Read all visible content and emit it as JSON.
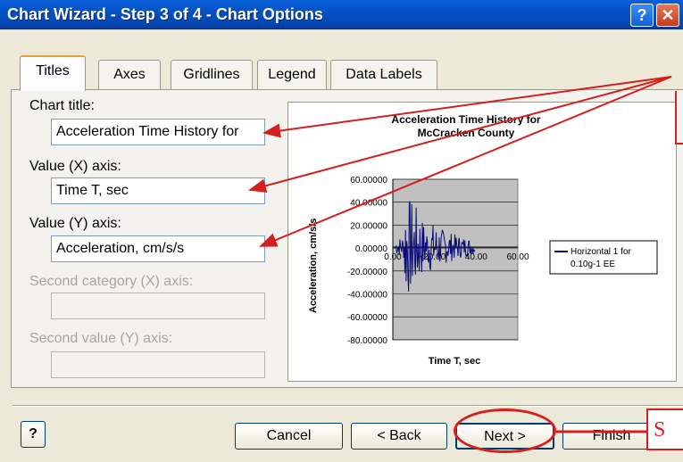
{
  "window": {
    "title": "Chart Wizard - Step 3 of 4 - Chart Options",
    "help_glyph": "?",
    "close_glyph": "✕"
  },
  "tabs": [
    {
      "label": "Titles",
      "active": true
    },
    {
      "label": "Axes"
    },
    {
      "label": "Gridlines"
    },
    {
      "label": "Legend"
    },
    {
      "label": "Data Labels"
    }
  ],
  "form": {
    "chart_title_label": "Chart title:",
    "chart_title_value": "Acceleration Time History for",
    "x_axis_label": "Value (X) axis:",
    "x_axis_value": "Time T, sec",
    "y_axis_label": "Value (Y) axis:",
    "y_axis_value": "Acceleration, cm/s/s",
    "second_x_label": "Second category (X) axis:",
    "second_y_label": "Second value (Y) axis:"
  },
  "preview": {
    "title_line1": "Acceleration Time History for",
    "title_line2": "McCracken County",
    "xlabel": "Time T, sec",
    "ylabel": "Acceleration, cm/s/s",
    "y_ticks": [
      "60.00000",
      "40.00000",
      "20.00000",
      "0.00000",
      "-20.00000",
      "-40.00000",
      "-60.00000",
      "-80.00000"
    ],
    "x_ticks": [
      "0.00",
      "20.00",
      "40.00",
      "60.00"
    ],
    "legend_line1": "Horizontal 1 for",
    "legend_line2": "0.10g-1 EE",
    "series_color": "#0a0a7a",
    "plot_bg": "#c0c0c0"
  },
  "buttons": {
    "help": "?",
    "cancel": "Cancel",
    "back": "< Back",
    "next": "Next >",
    "finish": "Finish"
  },
  "annotation": {
    "callout_letter": "S",
    "arrow_color": "#d41f1f"
  }
}
